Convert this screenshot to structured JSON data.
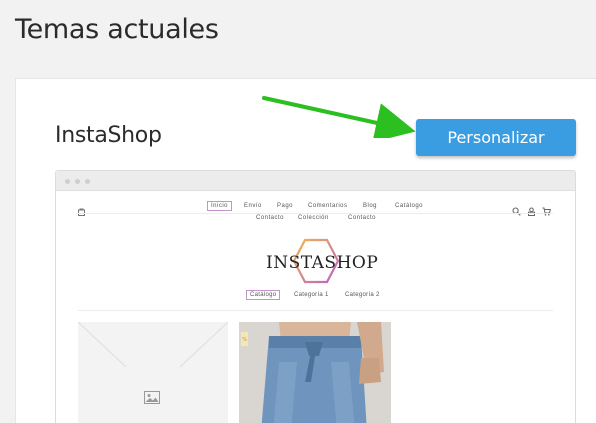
{
  "page": {
    "title": "Temas actuales"
  },
  "theme": {
    "name": "InstaShop",
    "customize_label": "Personalizar"
  },
  "preview": {
    "nav_row1": [
      "Inicio",
      "Envío",
      "Pago",
      "Comentarios",
      "Blog",
      "Catálogo"
    ],
    "nav_row2": [
      "Contacto",
      "Colección",
      "Contacto"
    ],
    "logo_text": "InstaShop",
    "categories": [
      "Catálogo",
      "Categoría 1",
      "Categoría 2"
    ],
    "products": [
      {
        "kind": "placeholder",
        "icon": "image-icon"
      },
      {
        "kind": "photo",
        "description_icon": "jeans-photo"
      }
    ]
  },
  "colors": {
    "accent_button": "#3a9de1",
    "arrow": "#2bbf1f",
    "logo_hex_start": "#f2b54b",
    "logo_hex_end": "#b862c7",
    "active_border": "#c493c9"
  }
}
